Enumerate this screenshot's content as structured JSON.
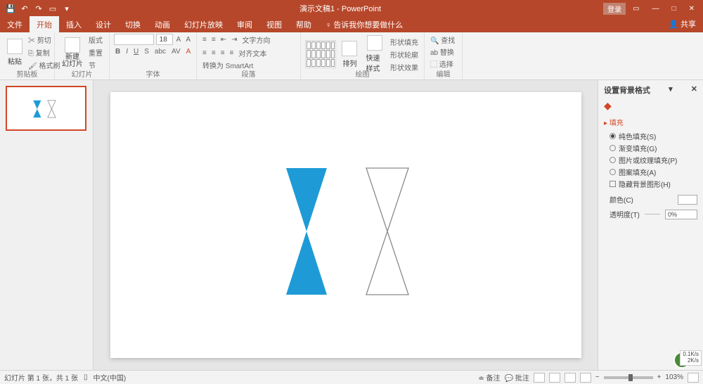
{
  "titlebar": {
    "title": "演示文稿1 - PowerPoint",
    "login": "登录"
  },
  "tabs": {
    "file": "文件",
    "home": "开始",
    "insert": "插入",
    "design": "设计",
    "transitions": "切换",
    "animations": "动画",
    "slideshow": "幻灯片放映",
    "review": "审阅",
    "view": "视图",
    "help": "帮助",
    "tellme": "告诉我你想要做什么",
    "share": "共享"
  },
  "ribbon": {
    "clipboard": {
      "label": "剪贴板",
      "paste": "粘贴",
      "cut": "剪切",
      "copy": "复制",
      "painter": "格式刷"
    },
    "slides": {
      "label": "幻灯片",
      "new": "新建\n幻灯片",
      "layout": "版式",
      "reset": "重置",
      "section": "节"
    },
    "font": {
      "label": "字体",
      "family": "",
      "size": "18"
    },
    "paragraph": {
      "label": "段落",
      "dir": "文字方向",
      "align": "对齐文本",
      "smart": "转换为 SmartArt"
    },
    "drawing": {
      "label": "绘图",
      "arrange": "排列",
      "quick": "快速样式",
      "fill": "形状填充",
      "outline": "形状轮廓",
      "effects": "形状效果"
    },
    "editing": {
      "label": "编辑",
      "find": "查找",
      "replace": "替换",
      "select": "选择"
    }
  },
  "panel": {
    "title": "设置背景格式",
    "section": "填充",
    "opts": {
      "solid": "纯色填充(S)",
      "gradient": "渐变填充(G)",
      "picture": "图片或纹理填充(P)",
      "pattern": "图案填充(A)",
      "hide": "隐藏背景图形(H)"
    },
    "color": "颜色(C)",
    "transparency": "透明度(T)",
    "trans_val": "0%"
  },
  "status": {
    "slide_info": "幻灯片 第 1 张，共 1 张",
    "lang": "中文(中国)",
    "notes": "备注",
    "comments": "批注",
    "zoom": "103%"
  },
  "net": {
    "up": "0.1K/s",
    "down": "2K/s"
  }
}
